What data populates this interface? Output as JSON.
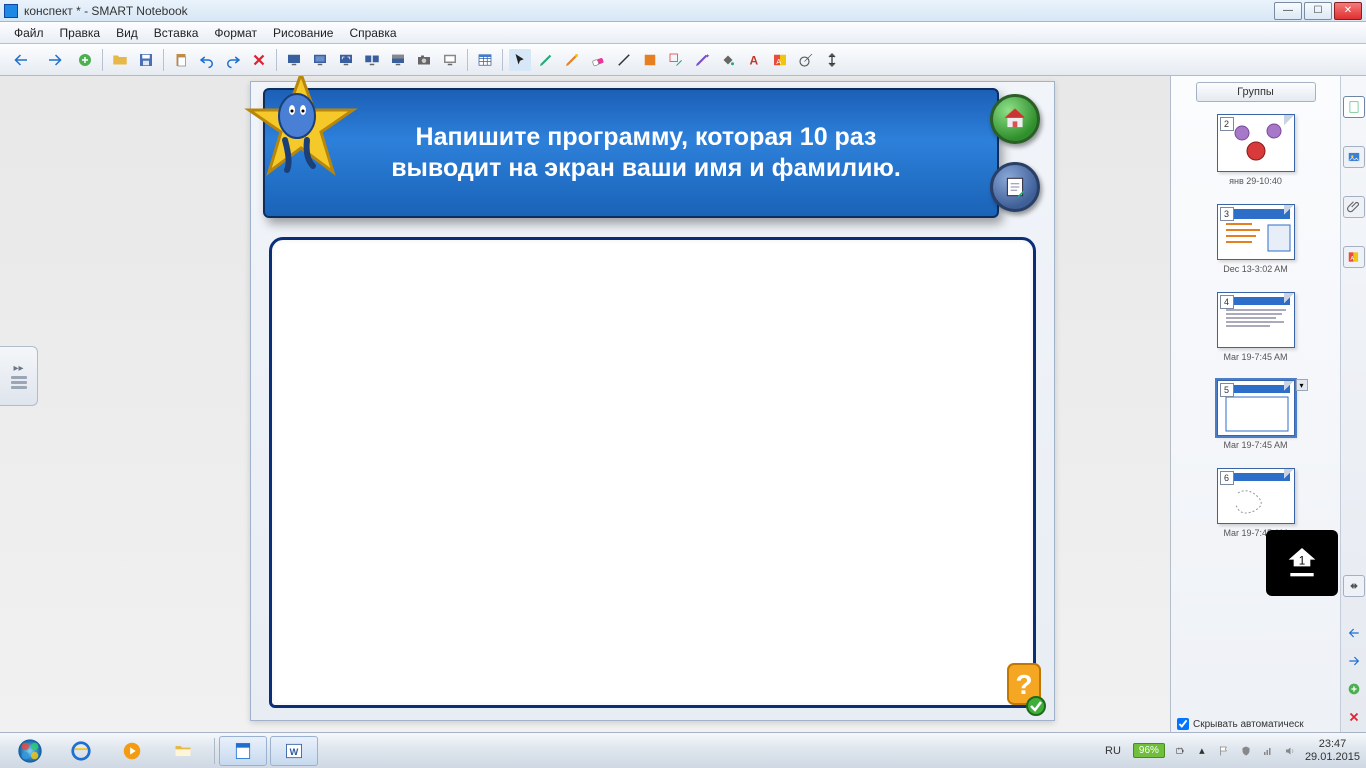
{
  "window": {
    "title": "конспект * - SMART Notebook"
  },
  "menu": {
    "file": "Файл",
    "edit": "Правка",
    "view": "Вид",
    "insert": "Вставка",
    "format": "Формат",
    "draw": "Рисование",
    "help": "Справка"
  },
  "slide": {
    "banner": "Напишите программу, которая 10 раз выводит на экран ваши имя и фамилию."
  },
  "panel": {
    "groups": "Группы",
    "thumbs": [
      {
        "num": "2",
        "caption": "янв 29-10:40",
        "style": "balloons"
      },
      {
        "num": "3",
        "caption": "Dec 13-3:02 AM",
        "style": "list"
      },
      {
        "num": "4",
        "caption": "Mar 19-7:45 AM",
        "style": "text"
      },
      {
        "num": "5",
        "caption": "Mar 19-7:45 AM",
        "style": "blank",
        "selected": true
      },
      {
        "num": "6",
        "caption": "Mar 19-7:45 AM",
        "style": "scribble"
      }
    ],
    "autohide": "Скрывать автоматическ"
  },
  "tray": {
    "lang": "RU",
    "battery": "96%",
    "time": "23:47",
    "date": "29.01.2015"
  }
}
